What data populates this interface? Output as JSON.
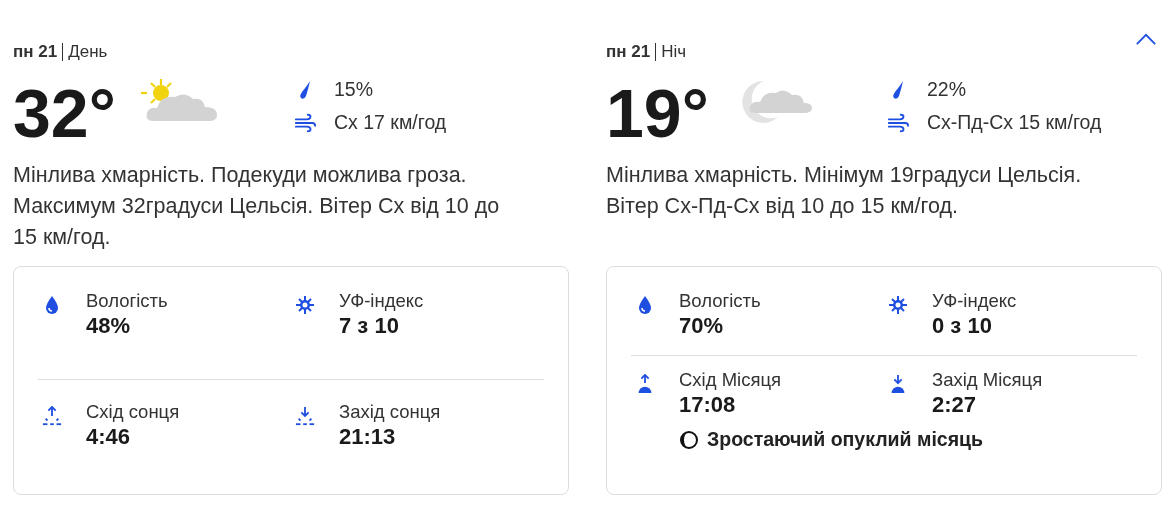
{
  "panels": [
    {
      "day": "пн 21",
      "period": "День",
      "kind": "day",
      "temperature": "32°",
      "precipitation": "15%",
      "wind": "Сх 17 км/год",
      "summary": "Мінлива хмарність. Подекуди можлива гроза. Максимум 32градуси Цельсія. Вітер Сх від 10 до 15 км/год.",
      "details": [
        [
          {
            "kind": "humidity",
            "label": "Вологість",
            "value": "48%"
          },
          {
            "kind": "uv",
            "label": "УФ-індекс",
            "value": "7 з 10"
          }
        ],
        [
          {
            "kind": "sunrise",
            "label": "Схід сонця",
            "value": "4:46"
          },
          {
            "kind": "sunset",
            "label": "Захід сонця",
            "value": "21:13"
          }
        ]
      ]
    },
    {
      "day": "пн 21",
      "period": "Ніч",
      "kind": "night",
      "temperature": "19°",
      "precipitation": "22%",
      "wind": "Сх-Пд-Сх 15 км/год",
      "summary": "Мінлива хмарність. Мінімум 19градуси Цельсія. Вітер Сх-Пд-Сх від 10 до 15 км/год.",
      "details": [
        [
          {
            "kind": "humidity",
            "label": "Вологість",
            "value": "70%"
          },
          {
            "kind": "uv",
            "label": "УФ-індекс",
            "value": "0 з 10"
          }
        ],
        [
          {
            "kind": "moonrise",
            "label": "Схід Місяця",
            "value": "17:08"
          },
          {
            "kind": "moonset",
            "label": "Захід Місяця",
            "value": "2:27"
          }
        ]
      ],
      "moon_phase": "Зростаючий опуклий місяць"
    }
  ]
}
